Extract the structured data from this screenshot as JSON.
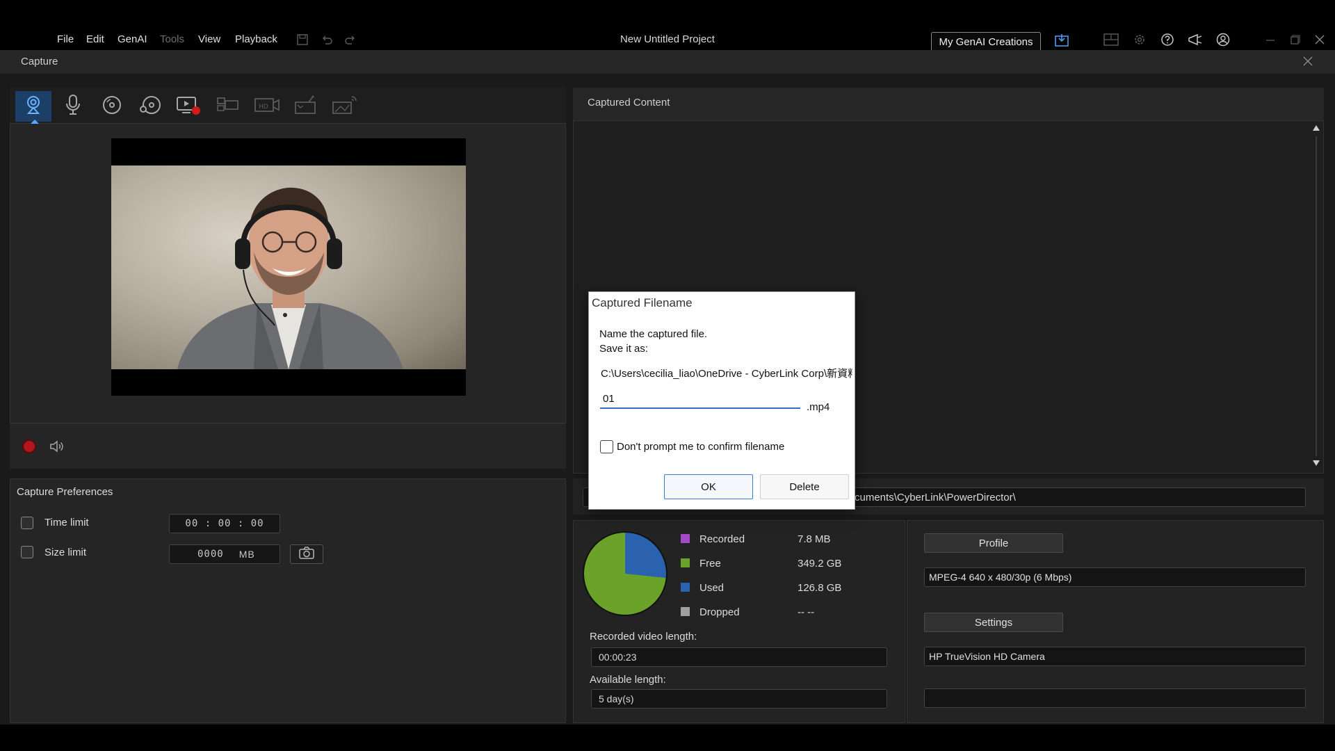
{
  "menu": {
    "items": [
      {
        "label": "File",
        "enabled": true
      },
      {
        "label": "Edit",
        "enabled": true
      },
      {
        "label": "GenAI",
        "enabled": true
      },
      {
        "label": "Tools",
        "enabled": false
      },
      {
        "label": "View",
        "enabled": true
      },
      {
        "label": "Playback",
        "enabled": true
      }
    ]
  },
  "titlebar": {
    "project_title": "New Untitled Project",
    "genai_button": "My GenAI Creations"
  },
  "capture": {
    "title": "Capture"
  },
  "tools": {
    "active_tool": "webcam-capture"
  },
  "preferences": {
    "title": "Capture Preferences",
    "time_limit_label": "Time limit",
    "time_limit_value": "00 : 00 : 00",
    "size_limit_label": "Size limit",
    "size_limit_value": "0000",
    "size_limit_unit": "MB"
  },
  "captured": {
    "title": "Captured Content",
    "path_visible": "cuments\\CyberLink\\PowerDirector\\"
  },
  "stats": {
    "recorded_label": "Recorded",
    "recorded_value": "7.8  MB",
    "free_label": "Free",
    "free_value": "349.2  GB",
    "used_label": "Used",
    "used_value": "126.8  GB",
    "dropped_label": "Dropped",
    "dropped_value": "-- --",
    "colors": {
      "recorded": "#a34bc7",
      "free": "#6aa22a",
      "used": "#2a62b0",
      "dropped": "#a0a0a0"
    },
    "recorded_length_label": "Recorded video length:",
    "recorded_length_value": "00:00:23",
    "available_length_label": "Available length:",
    "available_length_value": "5 day(s)"
  },
  "profile": {
    "profile_button": "Profile",
    "profile_value": "MPEG-4 640 x 480/30p (6 Mbps)",
    "settings_button": "Settings",
    "device_value": "HP TrueVision HD Camera",
    "extra_value": ""
  },
  "dialog": {
    "title": "Captured Filename",
    "message_line1": "Name the captured file.",
    "message_line2": "Save it as:",
    "path": "C:\\Users\\cecilia_liao\\OneDrive - CyberLink Corp\\新資料夾",
    "filename_value": "01",
    "extension": ".mp4",
    "dont_prompt_label": "Don't prompt me to confirm filename",
    "ok_label": "OK",
    "delete_label": "Delete"
  }
}
